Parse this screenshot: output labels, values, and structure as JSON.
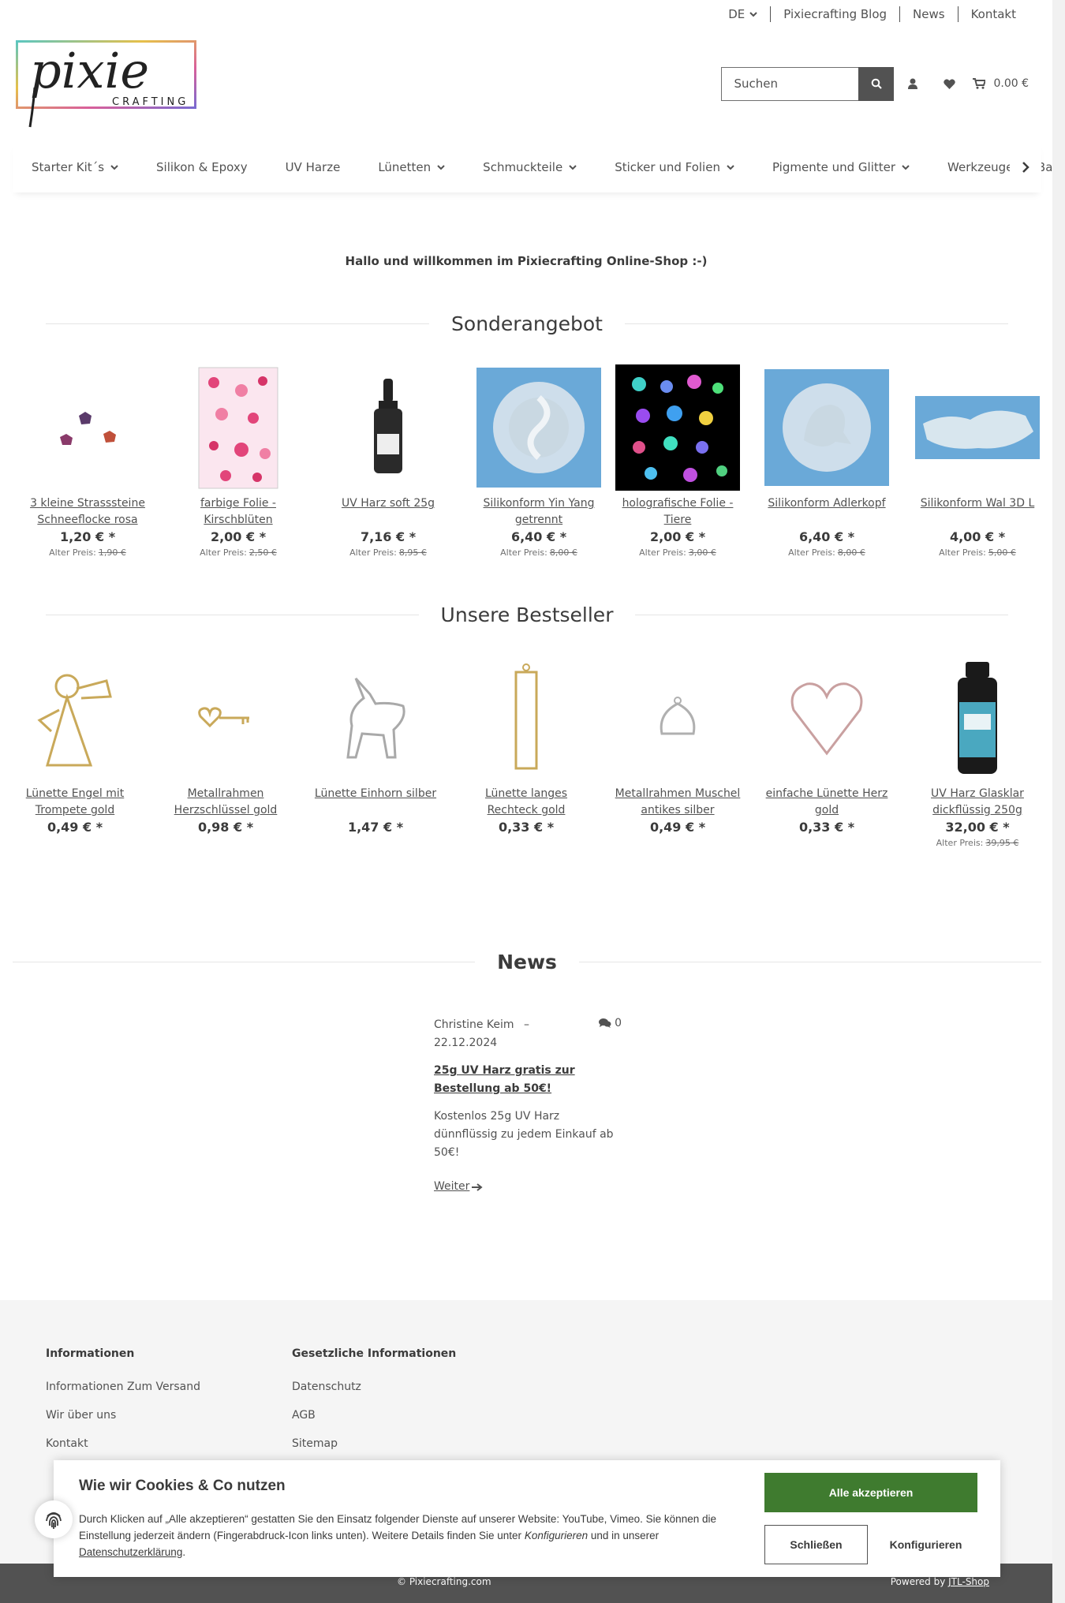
{
  "topbar": {
    "language": "DE",
    "links": [
      "Pixiecrafting Blog",
      "News",
      "Kontakt"
    ]
  },
  "logo": {
    "word": "pixie",
    "sub": "CRAFTING"
  },
  "search": {
    "placeholder": "Suchen"
  },
  "cart": {
    "total": "0.00 €"
  },
  "nav": [
    {
      "label": "Starter Kit´s",
      "dropdown": true
    },
    {
      "label": "Silikon & Epoxy",
      "dropdown": false
    },
    {
      "label": "UV Harze",
      "dropdown": false
    },
    {
      "label": "Lünetten",
      "dropdown": true
    },
    {
      "label": "Schmuckteile",
      "dropdown": true
    },
    {
      "label": "Sticker und Folien",
      "dropdown": true
    },
    {
      "label": "Pigmente und Glitter",
      "dropdown": true
    },
    {
      "label": "Werkzeuge für Bastler",
      "dropdown": false
    }
  ],
  "welcome": "Hallo und willkommen im Pixiecrafting Online-Shop :-)",
  "specials": {
    "title": "Sonderangebot",
    "old_label": "Alter Preis:",
    "items": [
      {
        "name": "3 kleine Strasssteine Schneeflocke rosa",
        "price": "1,20 € *",
        "old": "1,90 €"
      },
      {
        "name": "farbige Folie - Kirschblüten",
        "price": "2,00 € *",
        "old": "2,50 €"
      },
      {
        "name": "UV Harz soft 25g",
        "price": "7,16 € *",
        "old": "8,95 €"
      },
      {
        "name": "Silikonform Yin Yang getrennt",
        "price": "6,40 € *",
        "old": "8,00 €"
      },
      {
        "name": "holografische Folie - Tiere",
        "price": "2,00 € *",
        "old": "3,00 €"
      },
      {
        "name": "Silikonform Adlerkopf",
        "price": "6,40 € *",
        "old": "8,00 €"
      },
      {
        "name": "Silikonform Wal 3D L",
        "price": "4,00 € *",
        "old": "5,00 €"
      }
    ]
  },
  "bestsellers": {
    "title": "Unsere Bestseller",
    "items": [
      {
        "name": "Lünette Engel mit Trompete gold",
        "price": "0,49 € *",
        "old": ""
      },
      {
        "name": "Metallrahmen Herzschlüssel gold",
        "price": "0,98 € *",
        "old": ""
      },
      {
        "name": "Lünette Einhorn silber",
        "price": "1,47 € *",
        "old": ""
      },
      {
        "name": "Lünette langes Rechteck gold",
        "price": "0,33 € *",
        "old": ""
      },
      {
        "name": "Metallrahmen Muschel antikes silber",
        "price": "0,49 € *",
        "old": ""
      },
      {
        "name": "einfache Lünette Herz gold",
        "price": "0,33 € *",
        "old": ""
      },
      {
        "name": "UV Harz Glasklar dickflüssig 250g",
        "price": "32,00 € *",
        "old": "39,95 €"
      }
    ]
  },
  "news": {
    "title": "News",
    "author": "Christine Keim",
    "separator": "–",
    "date": "22.12.2024",
    "comments": "0",
    "headline": "25g UV Harz gratis zur Bestellung ab 50€!",
    "text": "Kostenlos 25g UV Harz dünnflüssig zu jedem Einkauf ab 50€!",
    "more": "Weiter"
  },
  "footer": {
    "col1": {
      "title": "Informationen",
      "links": [
        "Informationen Zum Versand",
        "Wir über uns",
        "Kontakt"
      ]
    },
    "col2": {
      "title": "Gesetzliche Informationen",
      "links": [
        "Datenschutz",
        "AGB",
        "Sitemap"
      ]
    },
    "copyright": "© Pixiecrafting.com",
    "powered_prefix": "Powered by",
    "powered_link": "JTL-Shop"
  },
  "cookie": {
    "title": "Wie wir Cookies & Co nutzen",
    "text_1": "Durch Klicken auf „Alle akzeptieren“ gestatten Sie den Einsatz folgender Dienste auf unserer Website: YouTube, Vimeo. Sie können die Einstellung jederzeit ändern (Fingerabdruck-Icon links unten). Weitere Details finden Sie unter ",
    "text_config": "Konfigurieren",
    "text_2": " und in unserer ",
    "text_link": "Datenschutzerklärung",
    "text_end": ".",
    "accept": "Alle akzeptieren",
    "close": "Schließen",
    "configure": "Konfigurieren"
  },
  "colors": {
    "accept": "#3f7b2f",
    "text": "#525252",
    "footer": "#f5f5f5",
    "bottombar": "#525252"
  }
}
